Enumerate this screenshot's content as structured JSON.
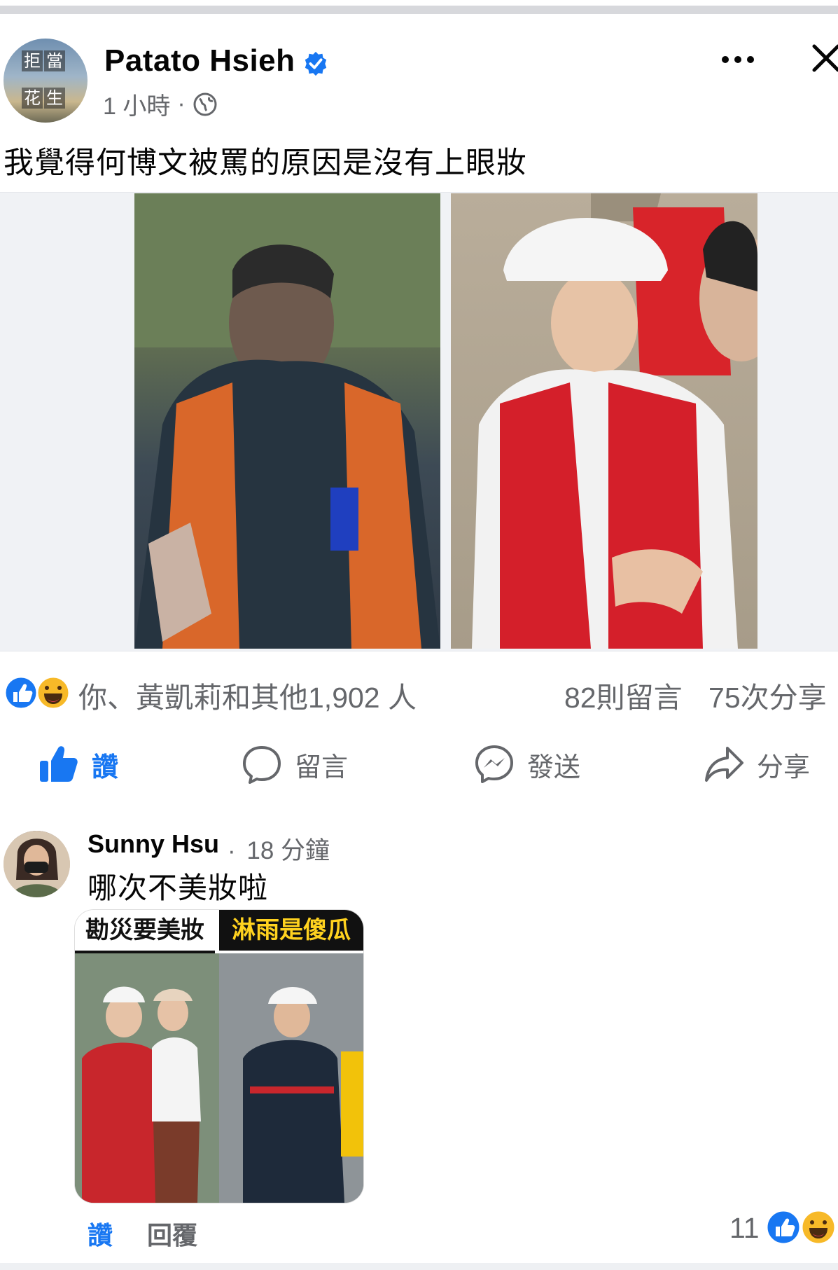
{
  "post": {
    "author": "Patato Hsieh",
    "time": "1 小時",
    "separator": "·",
    "caption": "我覺得何博文被罵的原因是沒有上眼妝",
    "avatar_text": [
      "拒",
      "當",
      "花",
      "生"
    ]
  },
  "stats": {
    "likes_text": "你、黃凱莉和其他1,902 人",
    "comments_text": "82則留言",
    "shares_text": "75次分享"
  },
  "actions": {
    "like": "讚",
    "comment": "留言",
    "send": "發送",
    "share": "分享"
  },
  "comment": {
    "author": "Sunny Hsu",
    "separator": "·",
    "time": "18 分鐘",
    "text": "哪次不美妝啦",
    "image_banner_left": "勘災要美妝",
    "image_banner_right": "淋雨是傻瓜",
    "like_label": "讚",
    "reply_label": "回覆",
    "reaction_count": "11"
  },
  "colors": {
    "brand_blue": "#1877f2",
    "secondary_text": "#65676b",
    "haha_yellow": "#f7b928"
  },
  "icons": {
    "verified": "verified-badge-icon",
    "more": "more-options-icon",
    "close": "close-icon",
    "globe": "globe-icon",
    "like": "thumbs-up-icon",
    "comment": "comment-bubble-icon",
    "send": "messenger-icon",
    "share": "share-arrow-icon"
  }
}
